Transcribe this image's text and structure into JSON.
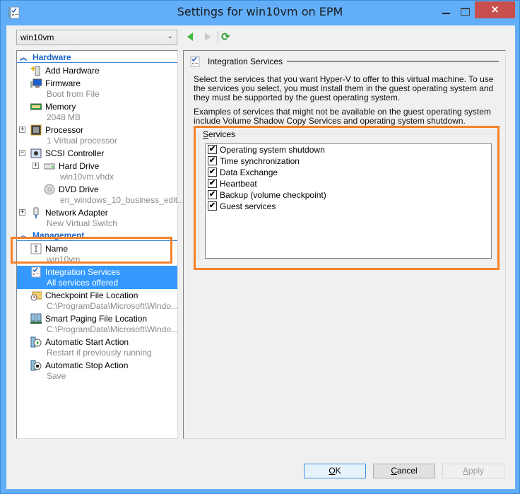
{
  "window": {
    "title": "Settings for win10vm on EPM",
    "controls": {
      "minimize": "minimize",
      "maximize": "maximize",
      "close": "×"
    }
  },
  "toolbar": {
    "vm_selector_value": "win10vm",
    "back_icon": "back-arrow-icon",
    "forward_icon": "forward-arrow-icon",
    "refresh_icon": "refresh-icon",
    "refresh_glyph": "⟳"
  },
  "tree": {
    "sections": [
      {
        "label": "Hardware",
        "collapse_glyph": "︽"
      },
      {
        "label": "Management",
        "collapse_glyph": "︽"
      }
    ],
    "hardware_items": [
      {
        "name": "Add Hardware",
        "sub": null,
        "icon": "add-hardware-icon"
      },
      {
        "name": "Firmware",
        "sub": "Boot from File",
        "icon": "firmware-icon"
      },
      {
        "name": "Memory",
        "sub": "2048 MB",
        "icon": "memory-icon"
      },
      {
        "name": "Processor",
        "sub": "1 Virtual processor",
        "icon": "processor-icon",
        "expander": "+"
      },
      {
        "name": "SCSI Controller",
        "sub": null,
        "icon": "scsi-controller-icon",
        "expander": "−"
      },
      {
        "name": "Hard Drive",
        "sub": "win10vm.vhdx",
        "icon": "hard-drive-icon",
        "expander": "+"
      },
      {
        "name": "DVD Drive",
        "sub": "en_windows_10_business_edit...",
        "icon": "dvd-drive-icon"
      },
      {
        "name": "Network Adapter",
        "sub": "New Virtual Switch",
        "icon": "network-adapter-icon",
        "expander": "+"
      }
    ],
    "management_items": [
      {
        "name": "Name",
        "sub": "win10vm",
        "icon": "name-icon"
      },
      {
        "name": "Integration Services",
        "sub": "All services offered",
        "icon": "integration-services-icon",
        "selected": true
      },
      {
        "name": "Checkpoint File Location",
        "sub": "C:\\ProgramData\\Microsoft\\Windo...",
        "icon": "checkpoint-folder-icon"
      },
      {
        "name": "Smart Paging File Location",
        "sub": "C:\\ProgramData\\Microsoft\\Windo...",
        "icon": "smart-paging-icon"
      },
      {
        "name": "Automatic Start Action",
        "sub": "Restart if previously running",
        "icon": "auto-start-icon"
      },
      {
        "name": "Automatic Stop Action",
        "sub": "Save",
        "icon": "auto-stop-icon"
      }
    ]
  },
  "detail": {
    "title": "Integration Services",
    "description": "Select the services that you want Hyper-V to offer to this virtual machine. To use the services you select, you must install them in the guest operating system and they must be supported by the guest operating system.",
    "examples": "Examples of services that might not be available on the guest operating system include Volume Shadow Copy Services and operating system shutdown.",
    "services_label": "Services",
    "services": [
      {
        "label": "Operating system shutdown",
        "checked": true
      },
      {
        "label": "Time synchronization",
        "checked": true
      },
      {
        "label": "Data Exchange",
        "checked": true
      },
      {
        "label": "Heartbeat",
        "checked": true
      },
      {
        "label": "Backup (volume checkpoint)",
        "checked": true
      },
      {
        "label": "Guest services",
        "checked": true
      }
    ],
    "check_glyph": "✔"
  },
  "buttons": {
    "ok": {
      "accel": "O",
      "rest": "K"
    },
    "cancel": {
      "accel": "C",
      "rest": "ancel"
    },
    "apply": {
      "accel": "A",
      "rest": "pply",
      "disabled": true
    }
  },
  "colors": {
    "titlebar": "#62aef8",
    "close_button": "#c7504f",
    "selection": "#3399ff",
    "section_header": "#1a64c8",
    "annotation_highlight": "#f5822b"
  }
}
